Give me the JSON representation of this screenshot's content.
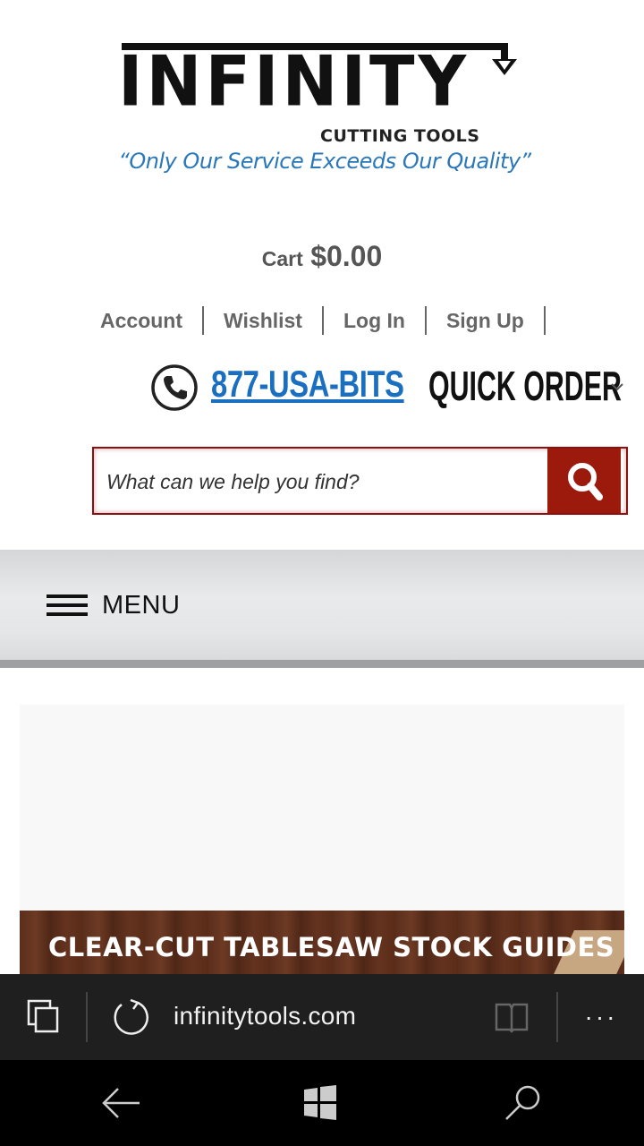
{
  "logo": {
    "wordmark": "INFINITY",
    "subtitle": "CUTTING TOOLS",
    "tagline": "“Only Our Service Exceeds Our Quality”"
  },
  "cart": {
    "label": "Cart",
    "amount": "$0.00"
  },
  "account_links": [
    "Account",
    "Wishlist",
    "Log In",
    "Sign Up"
  ],
  "phone": {
    "number": "877-USA-BITS"
  },
  "quick_order": {
    "label": "QUICK ORDER"
  },
  "search": {
    "placeholder": "What can we help you find?"
  },
  "menu": {
    "label": "MENU"
  },
  "banner": {
    "title": "CLEAR-CUT TABLESAW STOCK GUIDES"
  },
  "browser": {
    "url": "infinitytools.com"
  },
  "colors": {
    "accent_red": "#9c1a0c",
    "link_blue": "#1a6fc0",
    "tagline_blue": "#2a77b9",
    "browser_bg": "#1f1f1f"
  },
  "icons": [
    "phone-icon",
    "chevron-down-icon",
    "search-icon",
    "hamburger-icon",
    "tabs-icon",
    "refresh-icon",
    "reading-view-icon",
    "more-icon",
    "back-icon",
    "windows-start-icon",
    "search-icon"
  ]
}
